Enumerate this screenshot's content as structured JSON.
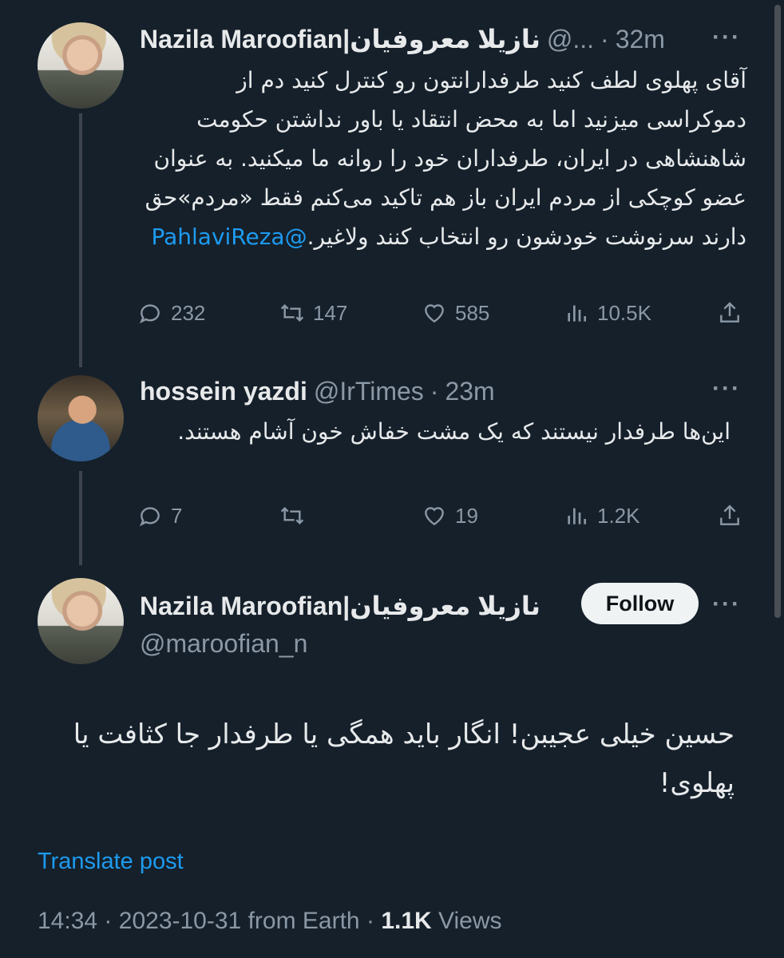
{
  "tweet1": {
    "name": "Nazila Maroofian|نازیلا معروفیان",
    "handle": "@...",
    "separator": "·",
    "time": "32m",
    "more_label": "···",
    "text_main": "آقای پهلوی لطف کنید طرفدارانتون رو کنترل کنید دم از دموکراسی میزنید اما به محض انتقاد یا باور نداشتن حکومت شاهنشاهی در ایران، طرفداران خود را روانه ما میکنید. به عنوان عضو کوچکی از مردم ایران باز هم تاکید می‌کنم فقط «مردم»حق دارند سرنوشت خودشون رو انتخاب کنند ولاغیر.",
    "mention": "@PahlaviReza",
    "replies": "232",
    "retweets": "147",
    "likes": "585",
    "views": "10.5K"
  },
  "tweet2": {
    "name": "hossein yazdi",
    "handle": "@IrTimes",
    "separator": "·",
    "time": "23m",
    "more_label": "···",
    "text": "این‌ها طرفدار نیستند که یک مشت خفاش خون آشام هستند.",
    "replies": "7",
    "retweets": "",
    "likes": "19",
    "views": "1.2K"
  },
  "main_tweet": {
    "name": "Nazila Maroofian|نازیلا معروفیان",
    "handle": "@maroofian_n",
    "follow_label": "Follow",
    "more_label": "···",
    "text": "حسین خیلی عجیبن! انگار باید همگی یا طرفدار جا کثافت یا پهلوی!",
    "translate_label": "Translate post",
    "time": "14:34",
    "date": "2023-10-31",
    "source": "from Earth",
    "views_count": "1.1K",
    "views_label": "Views",
    "separator": "·"
  },
  "colors": {
    "background": "#15202b",
    "text": "#e7e9ea",
    "muted": "#8b98a5",
    "link": "#1d9bf0"
  },
  "icons": [
    "more-icon",
    "reply-icon",
    "retweet-icon",
    "like-icon",
    "views-icon",
    "share-icon"
  ]
}
